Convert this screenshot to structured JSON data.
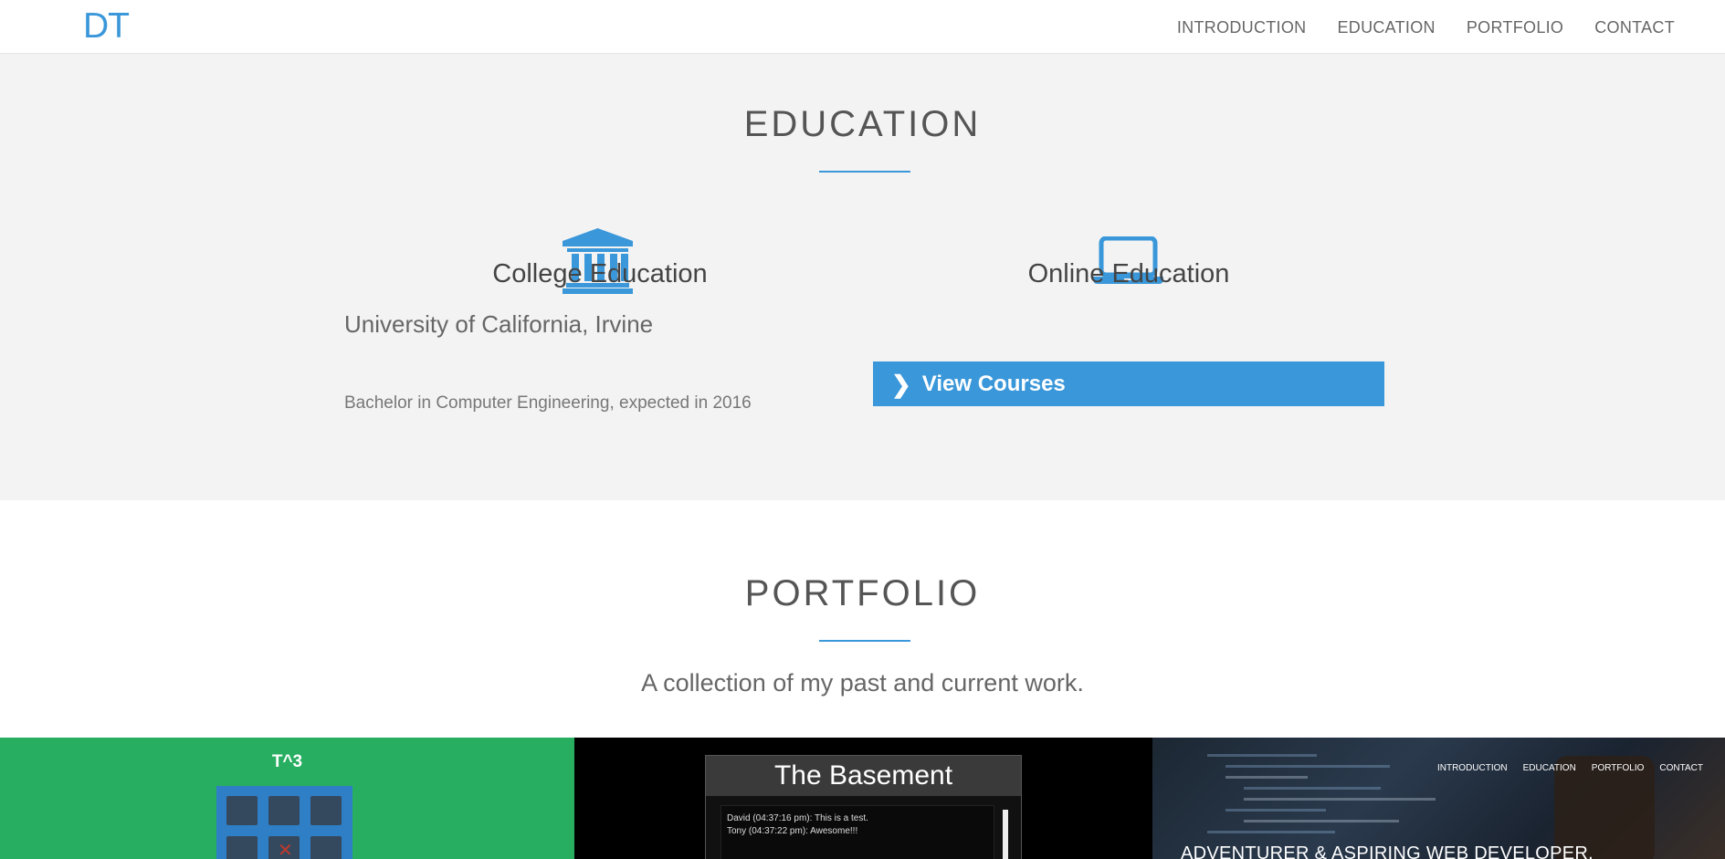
{
  "nav": {
    "brand": "DT",
    "links": [
      "INTRODUCTION",
      "EDUCATION",
      "PORTFOLIO",
      "CONTACT"
    ]
  },
  "education": {
    "title": "EDUCATION",
    "college": {
      "icon": "institution-icon",
      "heading": "College Education",
      "school": "University of California, Irvine",
      "degree": "Bachelor in Computer Engineering, expected in 2016"
    },
    "online": {
      "icon": "laptop-icon",
      "heading": "Online Education",
      "button_label": "View Courses"
    }
  },
  "portfolio": {
    "title": "PORTFOLIO",
    "subtitle": "A collection of my past and current work.",
    "projects": [
      {
        "title": "T^3",
        "color": "#27ae60"
      },
      {
        "title": "The Basement",
        "chat": [
          "David (04:37:16 pm): This is a test.",
          "Tony (04:37:22 pm): Awesome!!!"
        ]
      },
      {
        "nav": [
          "INTRODUCTION",
          "EDUCATION",
          "PORTFOLIO",
          "CONTACT"
        ],
        "tagline": "ADVENTURER & ASPIRING WEB DEVELOPER."
      }
    ]
  },
  "colors": {
    "accent": "#3a97d9",
    "section_bg": "#f3f3f3"
  }
}
